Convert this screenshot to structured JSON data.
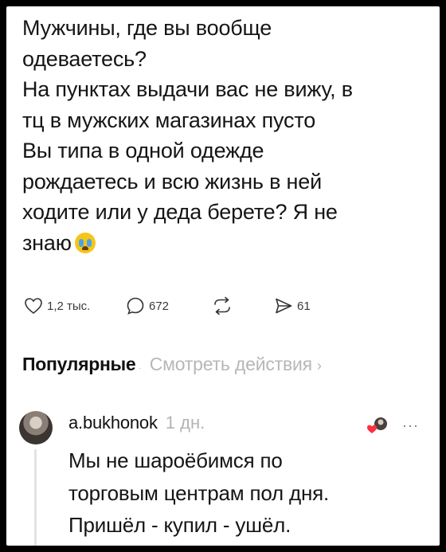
{
  "post": {
    "lines": [
      "Мужчины, где вы вообще",
      "одеваетесь?",
      "На пунктах выдачи вас не вижу, в",
      "тц в мужских магазинах пусто",
      "Вы типа в одной одежде",
      "рождаетесь и всю жизнь в ней",
      "ходите или у деда берете? Я не",
      "знаю"
    ],
    "emoji": "crying-face-emoji"
  },
  "actions": {
    "likes": "1,2 тыс.",
    "comments": "672",
    "reposts": "",
    "shares": "61"
  },
  "tabs": {
    "active": "Популярные",
    "separator": "·",
    "other": "Смотреть действия",
    "chevron": "›"
  },
  "comment": {
    "username": "a.bukhonok",
    "time": "1 дн.",
    "lines": [
      "Мы не шароёбимся по",
      "торговым центрам пол дня.",
      "Пришёл - купил - ушёл."
    ]
  },
  "colors": {
    "background": "#000000",
    "card": "#ffffff",
    "text": "#151515",
    "muted": "#b7b7b7"
  }
}
